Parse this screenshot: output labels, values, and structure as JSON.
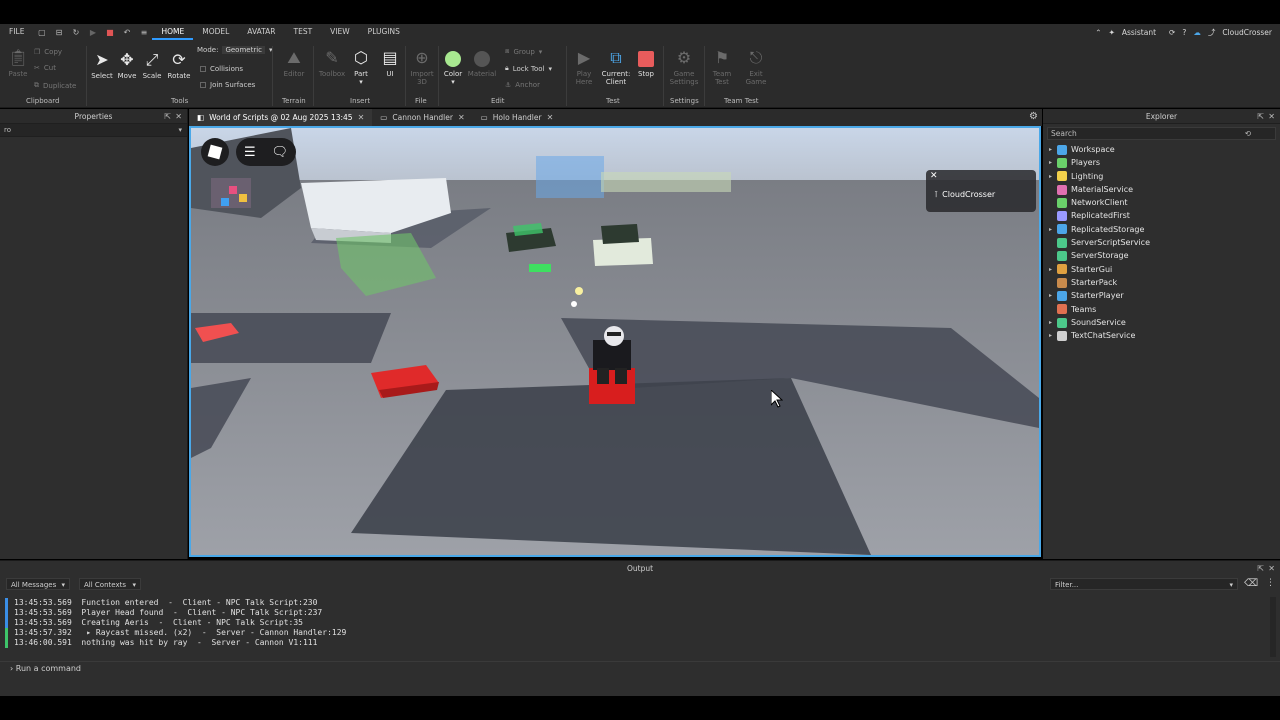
{
  "menu": {
    "file": "FILE",
    "tabs": [
      "HOME",
      "MODEL",
      "AVATAR",
      "TEST",
      "VIEW",
      "PLUGINS"
    ],
    "active_tab": "HOME",
    "assistant": "Assistant",
    "username": "CloudCrosser"
  },
  "ribbon": {
    "clipboard": {
      "paste": "Paste",
      "copy": "Copy",
      "cut": "Cut",
      "duplicate": "Duplicate",
      "label": "Clipboard"
    },
    "tools": {
      "select": "Select",
      "move": "Move",
      "scale": "Scale",
      "rotate": "Rotate",
      "mode_label": "Mode:",
      "mode_value": "Geometric",
      "collisions": "Collisions",
      "join_surfaces": "Join Surfaces",
      "label": "Tools"
    },
    "terrain": {
      "editor": "Editor",
      "label": "Terrain"
    },
    "insert": {
      "toolbox": "Toolbox",
      "part": "Part",
      "ui": "UI",
      "label": "Insert"
    },
    "file": {
      "import3d": "Import 3D",
      "label": "File"
    },
    "edit": {
      "color": "Color",
      "material": "Material",
      "group": "Group",
      "lock_tool": "Lock Tool",
      "anchor": "Anchor",
      "label": "Edit"
    },
    "test": {
      "play_here": "Play Here",
      "current": "Current:",
      "client": "Client",
      "stop": "Stop",
      "label": "Test"
    },
    "settings": {
      "game_settings": "Game Settings",
      "label": "Settings"
    },
    "team_test": {
      "team_test": "Team Test",
      "exit_game": "Exit Game",
      "label": "Team Test"
    }
  },
  "properties": {
    "title": "Properties",
    "filter_value": "ro"
  },
  "doc_tabs": [
    {
      "label": "World of Scripts @ 02 Aug 2025 13:45"
    },
    {
      "label": "Cannon Handler"
    },
    {
      "label": "Holo Handler"
    }
  ],
  "viewport": {
    "player_tag": "CloudCrosser"
  },
  "explorer": {
    "title": "Explorer",
    "search_placeholder": "Search",
    "items": [
      {
        "label": "Workspace",
        "icon": "globe-icon",
        "color": "#4ca6e8",
        "expandable": true
      },
      {
        "label": "Players",
        "icon": "players-icon",
        "color": "#6ad06a",
        "expandable": true
      },
      {
        "label": "Lighting",
        "icon": "bulb-icon",
        "color": "#f2d04b",
        "expandable": true
      },
      {
        "label": "MaterialService",
        "icon": "material-icon",
        "color": "#e070b0",
        "expandable": false
      },
      {
        "label": "NetworkClient",
        "icon": "network-icon",
        "color": "#6ad06a",
        "expandable": false
      },
      {
        "label": "ReplicatedFirst",
        "icon": "replicated-icon",
        "color": "#9a9aff",
        "expandable": false
      },
      {
        "label": "ReplicatedStorage",
        "icon": "replicated-storage-icon",
        "color": "#4ca6e8",
        "expandable": true
      },
      {
        "label": "ServerScriptService",
        "icon": "server-script-icon",
        "color": "#4cc88a",
        "expandable": false
      },
      {
        "label": "ServerStorage",
        "icon": "server-storage-icon",
        "color": "#4cc88a",
        "expandable": false
      },
      {
        "label": "StarterGui",
        "icon": "gui-icon",
        "color": "#e0a040",
        "expandable": true
      },
      {
        "label": "StarterPack",
        "icon": "pack-icon",
        "color": "#c88a4c",
        "expandable": false
      },
      {
        "label": "StarterPlayer",
        "icon": "player-icon",
        "color": "#4ca6e8",
        "expandable": true
      },
      {
        "label": "Teams",
        "icon": "teams-icon",
        "color": "#e07050",
        "expandable": false
      },
      {
        "label": "SoundService",
        "icon": "sound-icon",
        "color": "#4cc88a",
        "expandable": true
      },
      {
        "label": "TextChatService",
        "icon": "chat-icon",
        "color": "#cfcfcf",
        "expandable": true
      }
    ]
  },
  "output": {
    "title": "Output",
    "messages_filter": "All Messages",
    "contexts_filter": "All Contexts",
    "filter_placeholder": "Filter...",
    "lines": [
      {
        "text": "13:45:53.569  Function entered  -  Client - NPC Talk Script:230",
        "color": "#3a8ee6"
      },
      {
        "text": "13:45:53.569  Player Head found  -  Client - NPC Talk Script:237",
        "color": "#3a8ee6"
      },
      {
        "text": "13:45:53.569  Creating Aeris  -  Client - NPC Talk Script:35",
        "color": "#3a8ee6"
      },
      {
        "text": "13:45:57.392   ▸ Raycast missed. (x2)  -  Server - Cannon Handler:129",
        "color": "#3ec46a"
      },
      {
        "text": "13:46:00.591  nothing was hit by ray  -  Server - Cannon V1:111",
        "color": "#3ec46a"
      }
    ],
    "command_placeholder": "Run a command"
  }
}
